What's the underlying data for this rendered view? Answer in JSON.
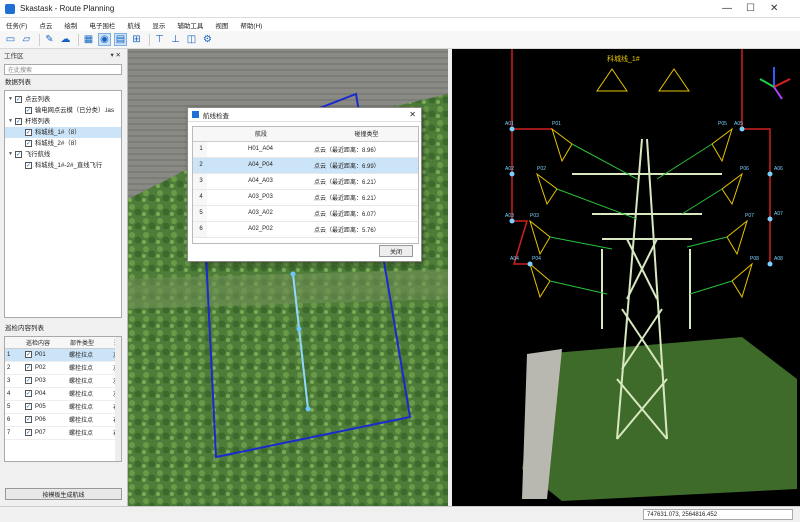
{
  "window": {
    "title": "Skastask - Route Planning",
    "min": "—",
    "max": "☐",
    "close": "✕"
  },
  "menu": [
    "任务(F)",
    "点云",
    "绘制",
    "电子围栏",
    "航线",
    "显示",
    "辅助工具",
    "视图",
    "帮助(H)"
  ],
  "toolbar": {
    "icons": [
      "new-file-icon",
      "open-folder-icon",
      "save-icon",
      "cloud-icon",
      "layers-icon",
      "map-icon",
      "route-icon",
      "grid-icon",
      "tower-icon",
      "tower-route-icon",
      "panel-icon",
      "settings-icon"
    ]
  },
  "left": {
    "panel_title": "工作区",
    "pin": "▾ ✕",
    "search_placeholder": "在此搜索",
    "data_list_label": "数据列表",
    "tree": [
      {
        "label": "点云列表",
        "level": 0,
        "expand": "▼"
      },
      {
        "label": "输电网点云模（已分类）.las",
        "level": 1
      },
      {
        "label": "杆塔列表",
        "level": 0,
        "expand": "▼"
      },
      {
        "label": "科城线_1#（8）",
        "level": 1,
        "selected": true
      },
      {
        "label": "科城线_2#（8）",
        "level": 1
      },
      {
        "label": "飞行航线",
        "level": 0,
        "expand": "▼"
      },
      {
        "label": "科城线_1#-2#_直线飞行",
        "level": 1
      }
    ],
    "route_list_label": "巡检内容列表",
    "route_table": {
      "headers": [
        "",
        "巡检内容",
        "部件类型",
        "巡"
      ],
      "rows": [
        {
          "idx": "1",
          "name": "P01",
          "type": "螺栓拉点",
          "extra": "左"
        },
        {
          "idx": "2",
          "name": "P02",
          "type": "螺栓拉点",
          "extra": "左"
        },
        {
          "idx": "3",
          "name": "P03",
          "type": "螺栓拉点",
          "extra": "左"
        },
        {
          "idx": "4",
          "name": "P04",
          "type": "螺栓拉点",
          "extra": "左"
        },
        {
          "idx": "5",
          "name": "P05",
          "type": "螺栓拉点",
          "extra": "右"
        },
        {
          "idx": "6",
          "name": "P06",
          "type": "螺栓拉点",
          "extra": "右"
        },
        {
          "idx": "7",
          "name": "P07",
          "type": "螺栓拉点",
          "extra": "右"
        }
      ]
    },
    "generate_button": "按模板生成航线"
  },
  "dialog": {
    "title": "航线检查",
    "headers": [
      "",
      "航段",
      "碰撞类型"
    ],
    "rows": [
      {
        "n": "1",
        "seg": "H01_A04",
        "type": "点云（最近距离：8.96）"
      },
      {
        "n": "2",
        "seg": "A04_P04",
        "type": "点云（最近距离：6.99）"
      },
      {
        "n": "3",
        "seg": "A04_A03",
        "type": "点云（最近距离：6.21）"
      },
      {
        "n": "4",
        "seg": "A03_P03",
        "type": "点云（最近距离：6.21）"
      },
      {
        "n": "5",
        "seg": "A03_A02",
        "type": "点云（最近距离：6.07）"
      },
      {
        "n": "6",
        "seg": "A02_P02",
        "type": "点云（最近距离：5.76）"
      }
    ],
    "ok": "关闭"
  },
  "view3d": {
    "tower_label": "科城线_1#",
    "waypoints_left": [
      "A01",
      "A02",
      "A03",
      "A04"
    ],
    "photos_left": [
      "P01",
      "P02",
      "P03",
      "P04"
    ],
    "waypoints_right": [
      "A05",
      "A06",
      "A07",
      "A08"
    ],
    "photos_right": [
      "P05",
      "P06",
      "P07",
      "P08"
    ]
  },
  "status": {
    "coords": "747631.073, 2564816.452"
  },
  "colors": {
    "accent": "#1e6fd6",
    "route_red": "#d0211f",
    "camera_yellow": "#e8c400",
    "ray_green": "#29c23a",
    "map_box": "#1a2ad0"
  }
}
